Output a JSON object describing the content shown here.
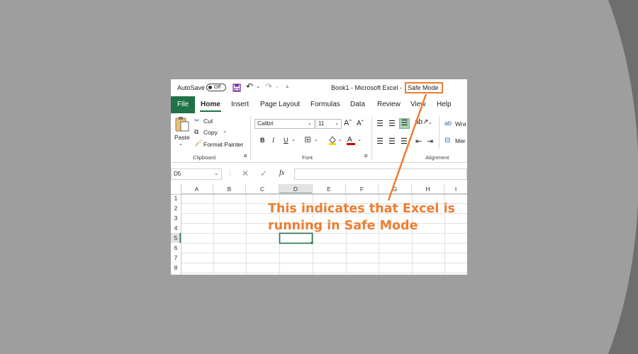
{
  "title_bar": {
    "autosave_label": "AutoSave",
    "autosave_state": "Off",
    "document_title": "Book1  -  Microsoft Excel  -",
    "mode_label": "Safe Mode"
  },
  "tabs": [
    {
      "label": "File",
      "active": false
    },
    {
      "label": "Home",
      "active": true
    },
    {
      "label": "Insert",
      "active": false
    },
    {
      "label": "Page Layout",
      "active": false
    },
    {
      "label": "Formulas",
      "active": false
    },
    {
      "label": "Data",
      "active": false
    },
    {
      "label": "Review",
      "active": false
    },
    {
      "label": "View",
      "active": false
    },
    {
      "label": "Help",
      "active": false
    }
  ],
  "ribbon": {
    "clipboard": {
      "paste_label": "Paste",
      "cut_label": "Cut",
      "copy_label": "Copy",
      "format_painter_label": "Format Painter",
      "group_label": "Clipboard"
    },
    "font": {
      "font_name": "Calibri",
      "font_size": "11",
      "bold": "B",
      "italic": "I",
      "underline": "U",
      "grow": "A",
      "shrink": "A",
      "group_label": "Font"
    },
    "alignment": {
      "wrap_label": "Wra",
      "merge_label": "Mer",
      "group_label": "Alignment"
    }
  },
  "formula_bar": {
    "name_box": "D5",
    "fx_label": "fx",
    "formula_value": ""
  },
  "grid": {
    "columns": [
      "A",
      "B",
      "C",
      "D",
      "E",
      "F",
      "G",
      "H",
      "I"
    ],
    "rows": [
      "1",
      "2",
      "3",
      "4",
      "5",
      "6",
      "7",
      "8"
    ],
    "selected_cell": "D5"
  },
  "annotation": {
    "line1": "This indicates that Excel is",
    "line2": "running in Safe Mode"
  },
  "colors": {
    "excel_green": "#217346",
    "accent_orange": "#ed7d31",
    "background_gray": "#9e9e9e"
  }
}
